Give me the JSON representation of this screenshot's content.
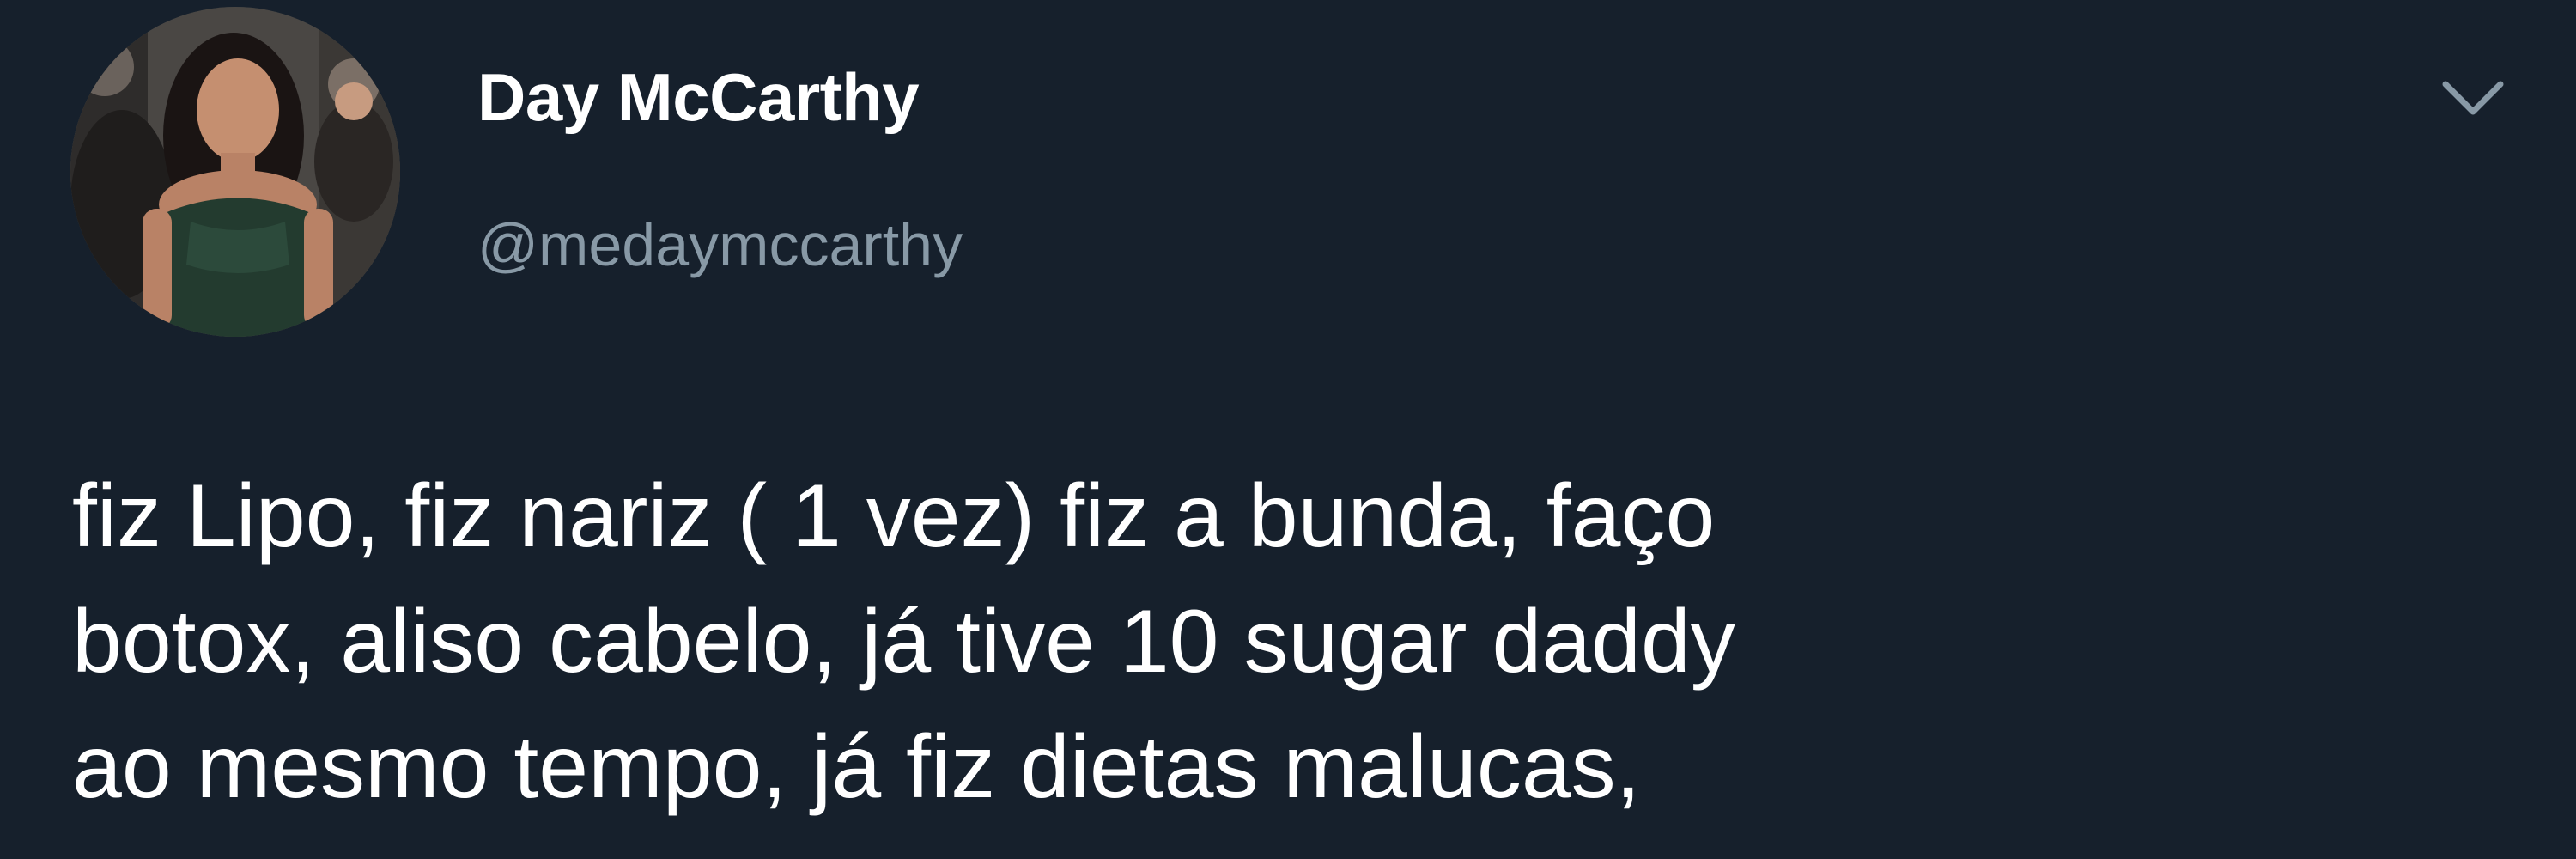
{
  "tweet": {
    "author": {
      "display_name": "Day McCarthy",
      "handle": "@medaymccarthy",
      "avatar": "profile-photo"
    },
    "menu_icon": "chevron-down-icon",
    "text_lines": [
      "fiz Lipo, fiz nariz ( 1 vez) fiz a bunda, faço",
      "botox, aliso cabelo, já tive 10 sugar daddy",
      "ao mesmo tempo, já fiz dietas malucas,"
    ]
  },
  "colors": {
    "background": "#16202c",
    "text_primary": "#ffffff",
    "text_secondary": "#8899a6"
  }
}
